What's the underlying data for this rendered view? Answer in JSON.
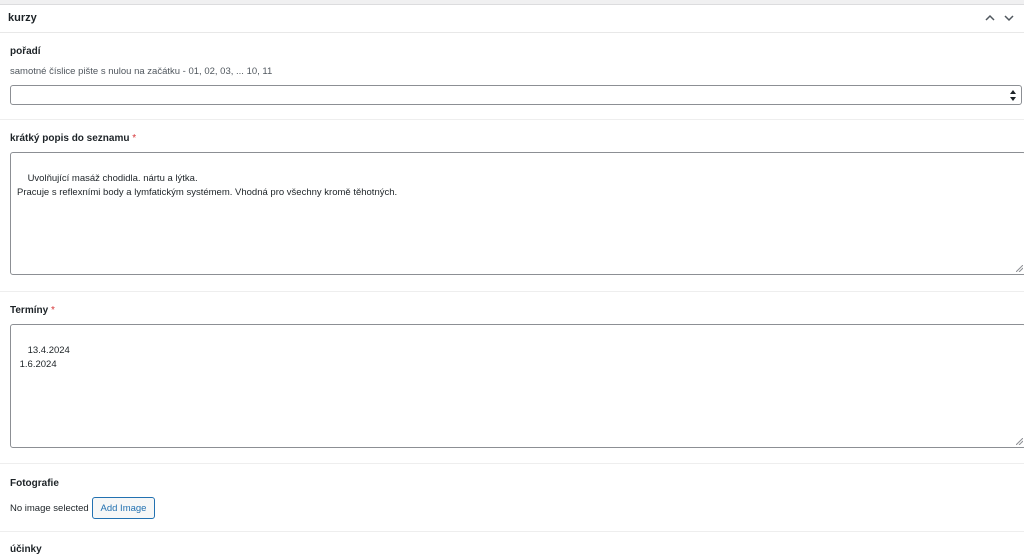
{
  "panel": {
    "title": "kurzy",
    "collapse_up_icon": "chevron-up-icon",
    "collapse_down_icon": "chevron-down-icon"
  },
  "fields": {
    "poradi": {
      "label": "pořadí",
      "description": "samotné číslice pište s nulou na začátku - 01, 02, 03, ... 10, 11",
      "value": ""
    },
    "kratky_popis": {
      "label": "krátký popis do seznamu",
      "required_mark": "*",
      "value": "Uvolňující masáž chodidla. nártu a lýtka.\nPracuje s reflexními body a lymfatickým systémem. Vhodná pro všechny kromě těhotných."
    },
    "terminy": {
      "label": "Termíny",
      "required_mark": "*",
      "value": "13.4.2024\n 1.6.2024"
    },
    "fotografie": {
      "label": "Fotografie",
      "status": "No image selected",
      "button_label": "Add Image"
    },
    "ucinky": {
      "label": "účinky"
    }
  },
  "colors": {
    "accent": "#2271b1",
    "required": "#d63638",
    "border": "#8c8f94"
  }
}
